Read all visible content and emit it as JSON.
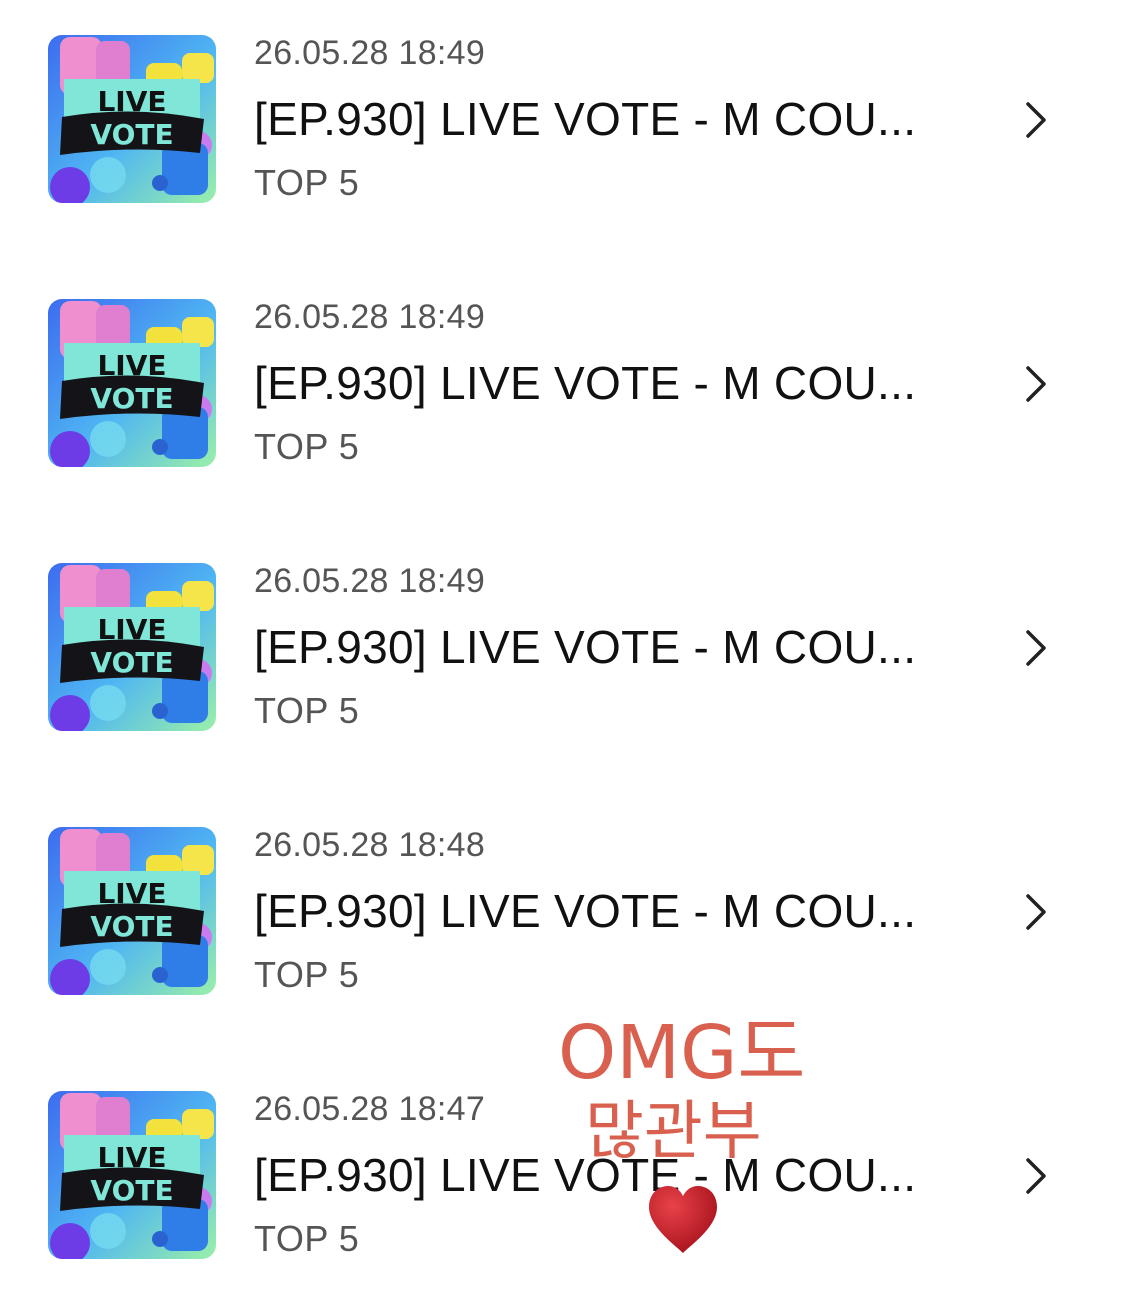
{
  "items": [
    {
      "date": "26.05.28 18:49",
      "title": "[EP.930] LIVE VOTE - M COU...",
      "subtitle": "TOP 5",
      "thumb": {
        "line1": "LIVE",
        "line2": "VOTE"
      }
    },
    {
      "date": "26.05.28 18:49",
      "title": "[EP.930] LIVE VOTE - M COU...",
      "subtitle": "TOP 5",
      "thumb": {
        "line1": "LIVE",
        "line2": "VOTE"
      }
    },
    {
      "date": "26.05.28 18:49",
      "title": "[EP.930] LIVE VOTE - M COU...",
      "subtitle": "TOP 5",
      "thumb": {
        "line1": "LIVE",
        "line2": "VOTE"
      }
    },
    {
      "date": "26.05.28 18:48",
      "title": "[EP.930] LIVE VOTE - M COU...",
      "subtitle": "TOP 5",
      "thumb": {
        "line1": "LIVE",
        "line2": "VOTE"
      }
    },
    {
      "date": "26.05.28 18:47",
      "title": "[EP.930] LIVE VOTE - M COU...",
      "subtitle": "TOP 5",
      "thumb": {
        "line1": "LIVE",
        "line2": "VOTE"
      }
    }
  ],
  "icons": {
    "row_action": "chevron-right-icon",
    "overlay_decoration": "heart-icon"
  },
  "overlay": {
    "line1": "OMG도",
    "line2": "많관부"
  },
  "colors": {
    "overlay_text": "#d9604e",
    "heart": "#c0171f",
    "thumb_banner": "#7fe6d8"
  }
}
